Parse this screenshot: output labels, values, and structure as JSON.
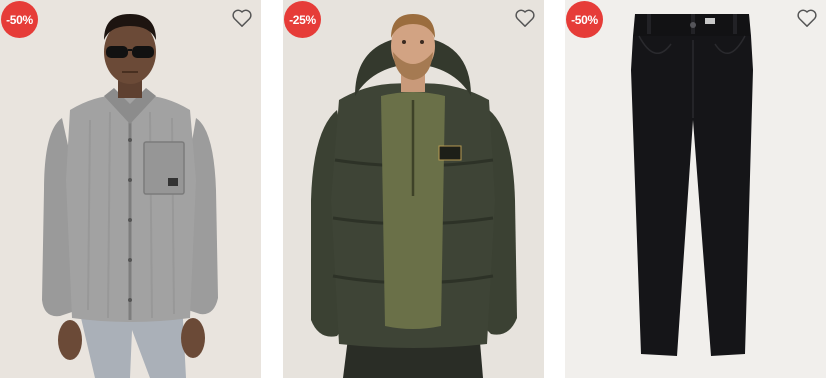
{
  "products": [
    {
      "discount": "-50%",
      "image": "grey-denim-shirt-model",
      "favorite_icon": "heart-outline-icon"
    },
    {
      "discount": "-25%",
      "image": "green-puffer-jacket-model",
      "favorite_icon": "heart-outline-icon"
    },
    {
      "discount": "-50%",
      "image": "black-jeans",
      "favorite_icon": "heart-outline-icon"
    }
  ],
  "colors": {
    "badge": "#e63c38",
    "card_bg_1": "#e9e4de",
    "card_bg_2": "#e7e3dd",
    "card_bg_3": "#f1efec"
  }
}
